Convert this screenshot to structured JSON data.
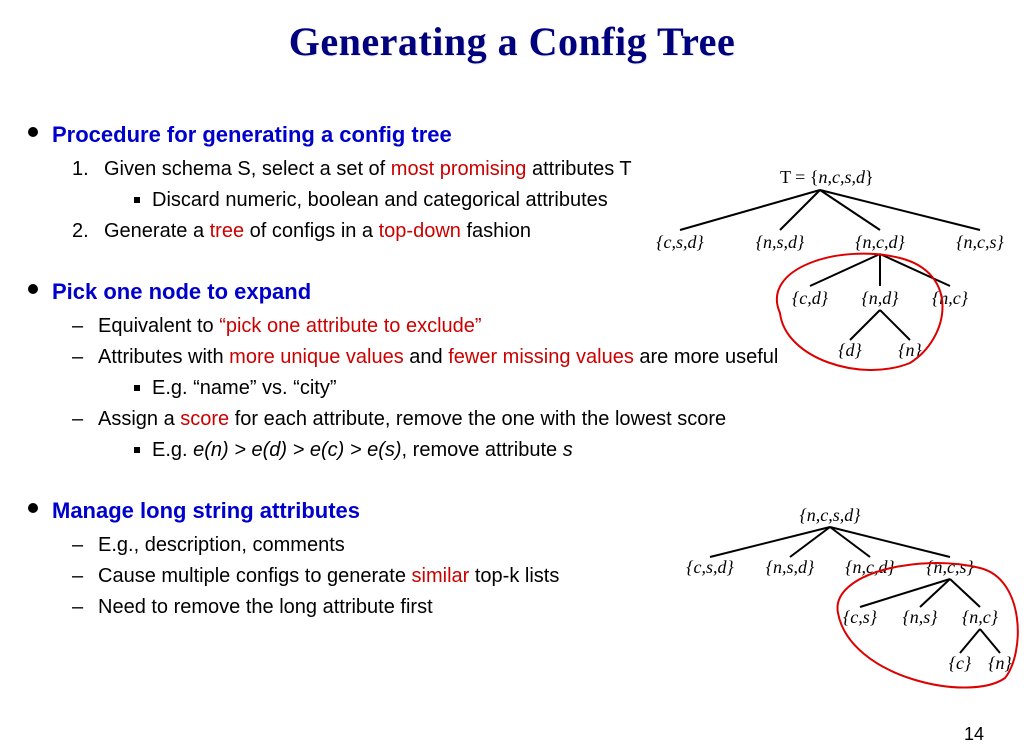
{
  "title": "Generating a Config Tree",
  "pageNumber": "14",
  "sec1": {
    "head": "Procedure for generating a config tree",
    "item1_pre": "Given schema S, select a set of ",
    "item1_red": "most promising",
    "item1_post": " attributes T",
    "item1_sub": "Discard numeric, boolean and categorical attributes",
    "item2_pre": "Generate a ",
    "item2_red1": "tree",
    "item2_mid": " of configs in a ",
    "item2_red2": "top-down",
    "item2_post": " fashion"
  },
  "sec2": {
    "head": "Pick one node to expand",
    "d1_pre": "Equivalent to ",
    "d1_red": "“pick one attribute to exclude”",
    "d2_pre": "Attributes with ",
    "d2_red1": "more unique values",
    "d2_mid": " and ",
    "d2_red2": "fewer missing values",
    "d2_post": " are more useful",
    "d2_sub": "E.g. “name” vs. “city”",
    "d3_pre": "Assign a ",
    "d3_red": "score",
    "d3_post": " for each attribute, remove the one with the lowest score",
    "d3_sub_pre": "E.g. ",
    "d3_sub_expr1": "e(n) > e(d) > e(c) > e(s)",
    "d3_sub_post": ", remove attribute ",
    "d3_sub_s": "s"
  },
  "sec3": {
    "head": "Manage long string attributes",
    "d1": "E.g., description, comments",
    "d2_pre": "Cause multiple configs to generate ",
    "d2_red": "similar",
    "d2_post": " top-k lists",
    "d3": "Need to remove the long attribute first"
  },
  "tree1": {
    "root_label": "T = {",
    "root_set": "n,c,s,d",
    "root_close": "}",
    "n1": "{c,s,d}",
    "n2": "{n,s,d}",
    "n3": "{n,c,d}",
    "n4": "{n,c,s}",
    "g1": "{c,d}",
    "g2": "{n,d}",
    "g3": "{n,c}",
    "gg1": "{d}",
    "gg2": "{n}"
  },
  "tree2": {
    "root": "{n,c,s,d}",
    "n1": "{c,s,d}",
    "n2": "{n,s,d}",
    "n3": "{n,c,d}",
    "n4": "{n,c,s}",
    "g1": "{c,s}",
    "g2": "{n,s}",
    "g3": "{n,c}",
    "gg1": "{c}",
    "gg2": "{n}"
  }
}
